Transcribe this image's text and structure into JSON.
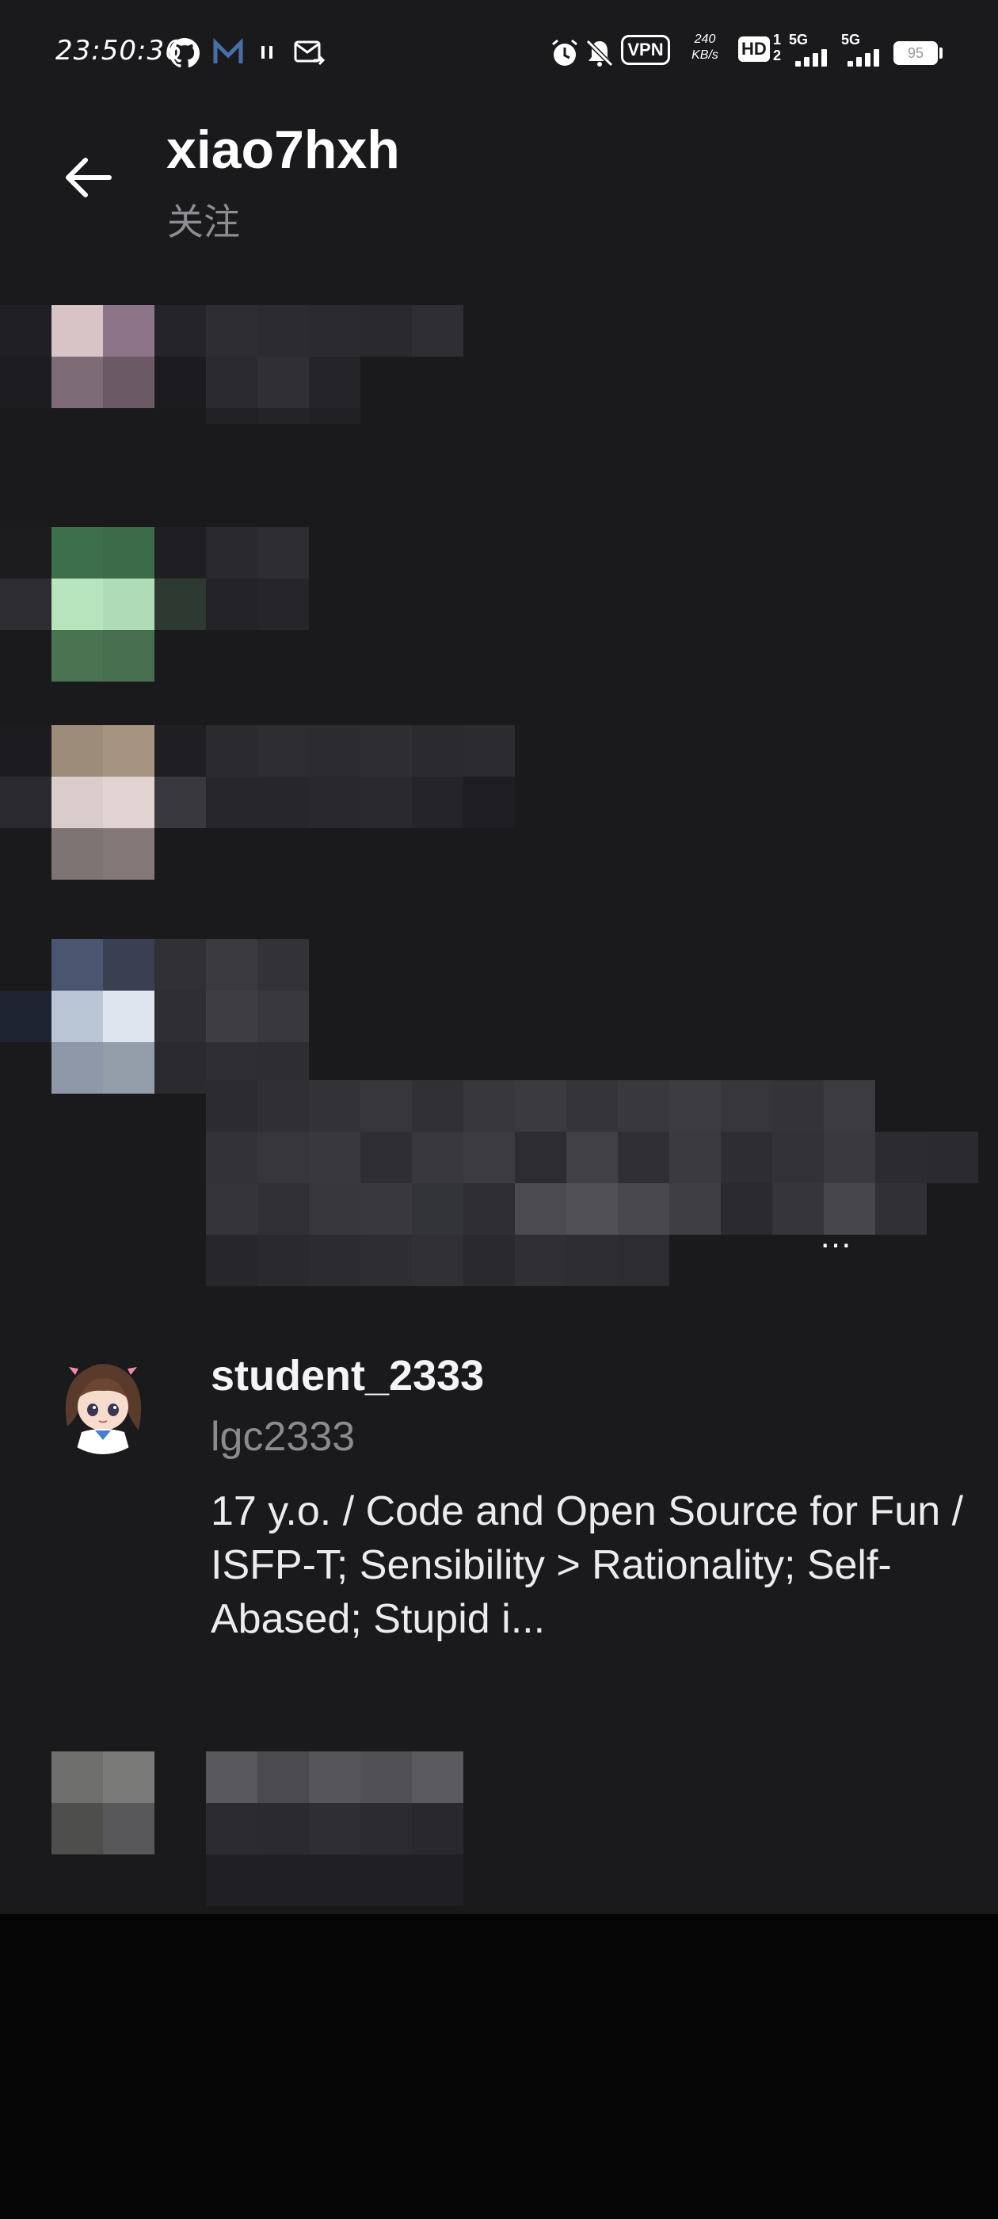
{
  "status_bar": {
    "time": "23:50:36",
    "speed_value": "240",
    "speed_unit": "KB/s",
    "vpn_label": "VPN",
    "hd_label": "HD",
    "hd_sim1": "1",
    "hd_sim2": "2",
    "network_1": "5G",
    "network_2": "5G",
    "battery_level": "95",
    "icons": [
      "github-icon",
      "mail-app-icon",
      "pause-icon",
      "mail-forward-icon",
      "alarm-icon",
      "bell-muted-icon"
    ]
  },
  "header": {
    "title": "xiao7hxh",
    "subtitle": "关注"
  },
  "follow_list": {
    "visible_user": {
      "name": "student_2333",
      "handle": "lgc2333",
      "bio": "17 y.o. / Code and Open Source for Fun / ISFP-T; Sensibility > Rationality; Self-Abased; Stupid i..."
    },
    "more_label": "…"
  },
  "colors": {
    "background": "#1a1a1d",
    "primary_text": "#f4f4f6",
    "secondary_text": "#8a8a8f"
  }
}
